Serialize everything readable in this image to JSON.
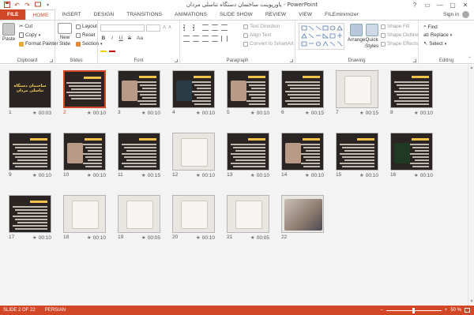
{
  "window": {
    "title": "پاورپوینت ساختمان دستگاه تناسلی مردان - PowerPoint",
    "qat_icons": [
      "save-icon",
      "undo-icon",
      "redo-icon",
      "start-from-beginning-icon",
      "customize-qat-icon"
    ],
    "controls": {
      "help": "?",
      "restore_ribbon": "▭",
      "minimize": "—",
      "maximize": "▢",
      "close": "✕"
    }
  },
  "tabs": [
    "FILE",
    "HOME",
    "INSERT",
    "DESIGN",
    "TRANSITIONS",
    "ANIMATIONS",
    "SLIDE SHOW",
    "REVIEW",
    "VIEW",
    "FILEminimizer"
  ],
  "active_tab": "HOME",
  "account": {
    "sign_in": "Sign in"
  },
  "ribbon": {
    "clipboard": {
      "label": "Clipboard",
      "paste": "Paste",
      "cut": "Cut",
      "copy": "Copy",
      "format_painter": "Format Painter"
    },
    "slides": {
      "label": "Slides",
      "new_slide_line1": "New",
      "new_slide_line2": "Slide",
      "layout": "Layout",
      "reset": "Reset",
      "section": "Section"
    },
    "font": {
      "label": "Font",
      "bold": "B",
      "italic": "I",
      "underline": "U",
      "strike": "S",
      "grow": "A",
      "shrink": "A",
      "aa": "Aa"
    },
    "paragraph": {
      "label": "Paragraph",
      "text_direction": "Text Direction",
      "align_text": "Align Text",
      "convert_smartart": "Convert to SmartArt"
    },
    "drawing": {
      "label": "Drawing",
      "arrange": "Arrange",
      "quick_styles_1": "Quick",
      "quick_styles_2": "Styles",
      "shape_fill": "Shape Fill",
      "shape_outline": "Shape Outline",
      "shape_effects": "Shape Effects"
    },
    "editing": {
      "label": "Editing",
      "find": "Find",
      "replace": "Replace",
      "select": "Select"
    }
  },
  "slides": [
    {
      "num": "1",
      "time": "00:03",
      "title_text": "ساختمان دستگاه تناسلی مردان"
    },
    {
      "num": "2",
      "time": "00:10",
      "selected": true
    },
    {
      "num": "3",
      "time": "00:10"
    },
    {
      "num": "4",
      "time": "00:10"
    },
    {
      "num": "5",
      "time": "00:10"
    },
    {
      "num": "6",
      "time": "00:15"
    },
    {
      "num": "7",
      "time": "00:15"
    },
    {
      "num": "8",
      "time": "00:10"
    },
    {
      "num": "9",
      "time": "00:10"
    },
    {
      "num": "10",
      "time": "00:10"
    },
    {
      "num": "11",
      "time": "00:15"
    },
    {
      "num": "12",
      "time": "00:10"
    },
    {
      "num": "13",
      "time": "00:10"
    },
    {
      "num": "14",
      "time": "00:10"
    },
    {
      "num": "15",
      "time": "00:10"
    },
    {
      "num": "16",
      "time": "00:10"
    },
    {
      "num": "17",
      "time": "00:10"
    },
    {
      "num": "18",
      "time": "00:10"
    },
    {
      "num": "19",
      "time": "00:05"
    },
    {
      "num": "20",
      "time": "00:10"
    },
    {
      "num": "21",
      "time": "00:05"
    },
    {
      "num": "22",
      "time": ""
    }
  ],
  "status": {
    "slide_info": "SLIDE 2 OF 22",
    "language": "PERSIAN",
    "zoom_minus": "–",
    "zoom_plus": "+",
    "zoom": "50 %",
    "zoom_fraction": 0.5
  },
  "colors": {
    "accent": "#d24726",
    "slide_bg": "#2a2522",
    "title_yellow": "#f2c24a"
  }
}
